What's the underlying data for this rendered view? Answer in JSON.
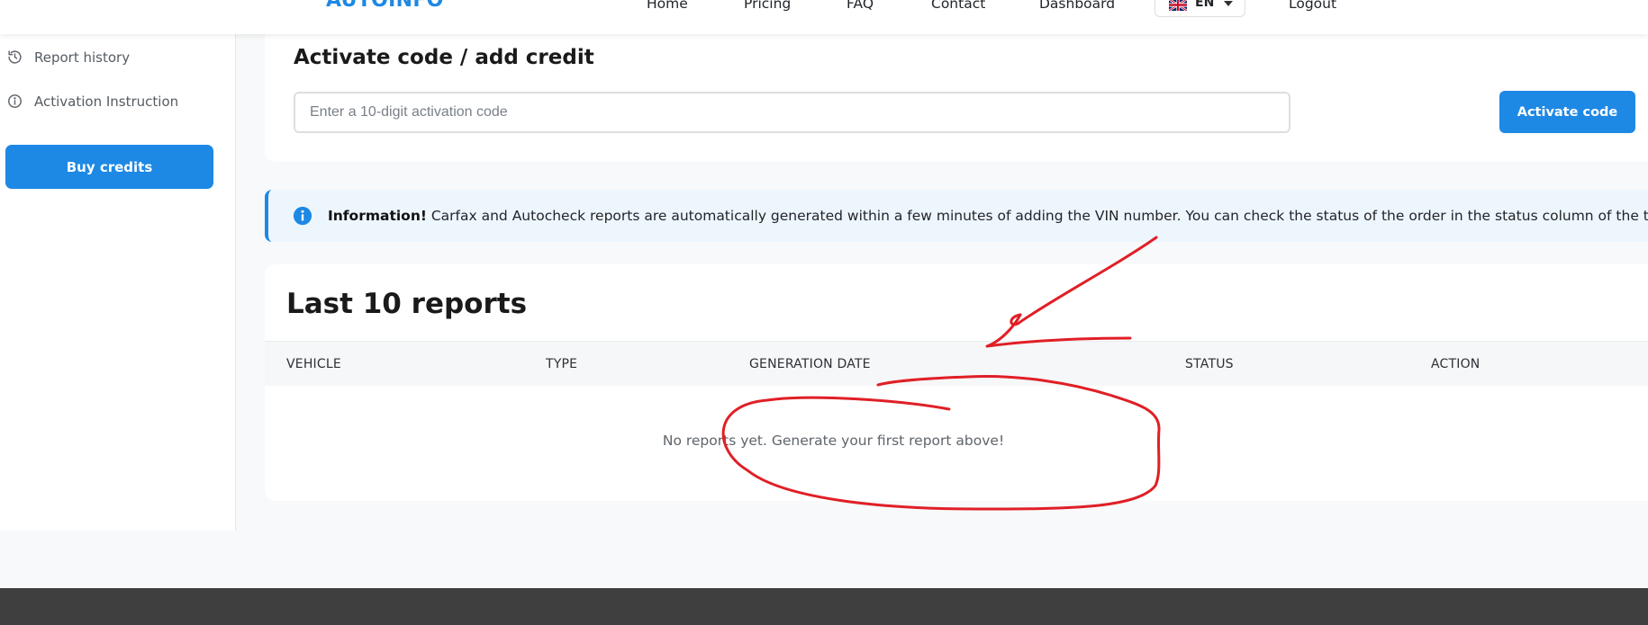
{
  "navbar": {
    "brand": "AUTOINFO",
    "brand_color": "#1e88e5",
    "links": {
      "home": "Home",
      "pricing": "Pricing",
      "faq": "FAQ",
      "contact": "Contact",
      "dashboard": "Dashboard",
      "logout": "Logout"
    },
    "language": {
      "code": "EN",
      "flag_icon": "uk-flag-icon"
    }
  },
  "sidebar": {
    "items": [
      {
        "label": "Report history",
        "icon": "history-icon"
      },
      {
        "label": "Activation Instruction",
        "icon": "info-circle-icon"
      }
    ],
    "buy_credits_label": "Buy credits"
  },
  "activation": {
    "title": "Activate code / add credit",
    "input_placeholder": "Enter a 10-digit activation code",
    "input_value": "",
    "button_label": "Activate code"
  },
  "info_alert": {
    "icon": "info-icon",
    "strong": "Information!",
    "text": " Carfax and Autocheck reports are automatically generated within a few minutes of adding the VIN number. You can check the status of the order in the status column of the table below."
  },
  "reports": {
    "title": "Last 10 reports",
    "columns": {
      "vehicle": "VEHICLE",
      "type": "TYPE",
      "generation_date": "GENERATION DATE",
      "status": "STATUS",
      "action": "ACTION"
    },
    "rows": [],
    "empty_message": "No reports yet. Generate your first report above!"
  },
  "colors": {
    "accent": "#1e88e5",
    "annotation_red": "#e01f26",
    "footer": "#3f3f3f",
    "alert_background": "#eef6fd"
  }
}
